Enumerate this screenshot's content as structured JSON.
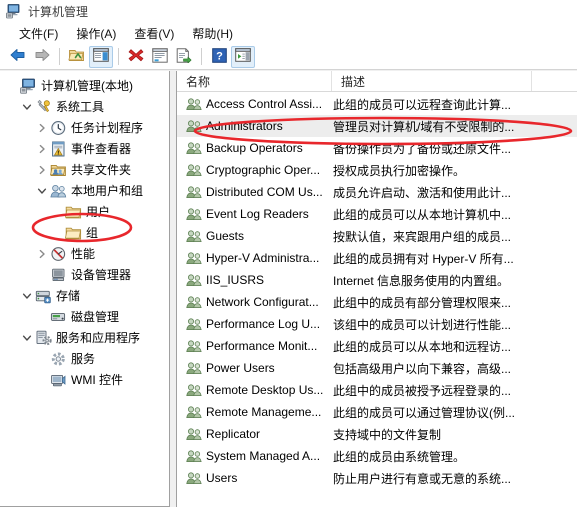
{
  "window": {
    "title": "计算机管理",
    "icon": "computer-management-icon"
  },
  "menu": {
    "items": [
      {
        "label": "文件(F)",
        "name": "menu-file"
      },
      {
        "label": "操作(A)",
        "name": "menu-action"
      },
      {
        "label": "查看(V)",
        "name": "menu-view"
      },
      {
        "label": "帮助(H)",
        "name": "menu-help"
      }
    ]
  },
  "toolbar": {
    "buttons": [
      {
        "icon": "back-arrow-icon",
        "name": "toolbar-back"
      },
      {
        "icon": "forward-arrow-icon",
        "name": "toolbar-forward"
      },
      {
        "icon": "up-folder-icon",
        "name": "toolbar-up-folder"
      },
      {
        "icon": "show-hide-tree-icon",
        "name": "toolbar-show-tree"
      },
      {
        "icon": "delete-red-x-icon",
        "name": "toolbar-delete"
      },
      {
        "icon": "properties-icon",
        "name": "toolbar-properties"
      },
      {
        "icon": "export-list-icon",
        "name": "toolbar-export-list"
      },
      {
        "icon": "help-question-icon",
        "name": "toolbar-help"
      },
      {
        "icon": "show-action-pane-icon",
        "name": "toolbar-action-pane"
      }
    ]
  },
  "tree": {
    "nodes": [
      {
        "label": "计算机管理(本地)",
        "indent": 0,
        "chevron": "none",
        "icon": "computer-icon",
        "name": "tree-computer-management-local"
      },
      {
        "label": "系统工具",
        "indent": 1,
        "chevron": "expanded",
        "icon": "system-tools-icon",
        "name": "tree-system-tools"
      },
      {
        "label": "任务计划程序",
        "indent": 2,
        "chevron": "collapsed",
        "icon": "task-scheduler-icon",
        "name": "tree-task-scheduler"
      },
      {
        "label": "事件查看器",
        "indent": 2,
        "chevron": "collapsed",
        "icon": "event-viewer-icon",
        "name": "tree-event-viewer"
      },
      {
        "label": "共享文件夹",
        "indent": 2,
        "chevron": "collapsed",
        "icon": "shared-folders-icon",
        "name": "tree-shared-folders"
      },
      {
        "label": "本地用户和组",
        "indent": 2,
        "chevron": "expanded",
        "icon": "local-users-groups-icon",
        "name": "tree-local-users-and-groups"
      },
      {
        "label": "用户",
        "indent": 3,
        "chevron": "none",
        "icon": "folder-icon",
        "name": "tree-users-folder"
      },
      {
        "label": "组",
        "indent": 3,
        "chevron": "none",
        "icon": "folder-icon",
        "name": "tree-groups-folder"
      },
      {
        "label": "性能",
        "indent": 2,
        "chevron": "collapsed",
        "icon": "performance-icon",
        "name": "tree-performance"
      },
      {
        "label": "设备管理器",
        "indent": 2,
        "chevron": "none",
        "icon": "device-manager-icon",
        "name": "tree-device-manager"
      },
      {
        "label": "存储",
        "indent": 1,
        "chevron": "expanded",
        "icon": "storage-icon",
        "name": "tree-storage"
      },
      {
        "label": "磁盘管理",
        "indent": 2,
        "chevron": "none",
        "icon": "disk-management-icon",
        "name": "tree-disk-management"
      },
      {
        "label": "服务和应用程序",
        "indent": 1,
        "chevron": "expanded",
        "icon": "services-apps-icon",
        "name": "tree-services-and-applications"
      },
      {
        "label": "服务",
        "indent": 2,
        "chevron": "none",
        "icon": "services-gear-icon",
        "name": "tree-services"
      },
      {
        "label": "WMI 控件",
        "indent": 2,
        "chevron": "none",
        "icon": "wmi-control-icon",
        "name": "tree-wmi-control"
      }
    ]
  },
  "list": {
    "columns": [
      {
        "label": "名称",
        "name": "column-header-name"
      },
      {
        "label": "描述",
        "name": "column-header-description"
      }
    ],
    "rows": [
      {
        "name": "Access Control Assi...",
        "description": "此组的成员可以远程查询此计算...",
        "selected": false,
        "icon": "group-icon"
      },
      {
        "name": "Administrators",
        "description": "管理员对计算机/域有不受限制的...",
        "selected": true,
        "icon": "group-icon"
      },
      {
        "name": "Backup Operators",
        "description": "备份操作员为了备份或还原文件...",
        "selected": false,
        "icon": "group-icon"
      },
      {
        "name": "Cryptographic Oper...",
        "description": "授权成员执行加密操作。",
        "selected": false,
        "icon": "group-icon"
      },
      {
        "name": "Distributed COM Us...",
        "description": "成员允许启动、激活和使用此计...",
        "selected": false,
        "icon": "group-icon"
      },
      {
        "name": "Event Log Readers",
        "description": "此组的成员可以从本地计算机中...",
        "selected": false,
        "icon": "group-icon"
      },
      {
        "name": "Guests",
        "description": "按默认值，来宾跟用户组的成员...",
        "selected": false,
        "icon": "group-icon"
      },
      {
        "name": "Hyper-V Administra...",
        "description": "此组的成员拥有对 Hyper-V 所有...",
        "selected": false,
        "icon": "group-icon"
      },
      {
        "name": "IIS_IUSRS",
        "description": "Internet 信息服务使用的内置组。",
        "selected": false,
        "icon": "group-icon"
      },
      {
        "name": "Network Configurat...",
        "description": "此组中的成员有部分管理权限来...",
        "selected": false,
        "icon": "group-icon"
      },
      {
        "name": "Performance Log U...",
        "description": "该组中的成员可以计划进行性能...",
        "selected": false,
        "icon": "group-icon"
      },
      {
        "name": "Performance Monit...",
        "description": "此组的成员可以从本地和远程访...",
        "selected": false,
        "icon": "group-icon"
      },
      {
        "name": "Power Users",
        "description": "包括高级用户以向下兼容，高级...",
        "selected": false,
        "icon": "group-icon"
      },
      {
        "name": "Remote Desktop Us...",
        "description": "此组中的成员被授予远程登录的...",
        "selected": false,
        "icon": "group-icon"
      },
      {
        "name": "Remote Manageme...",
        "description": "此组的成员可以通过管理协议(例...",
        "selected": false,
        "icon": "group-icon"
      },
      {
        "name": "Replicator",
        "description": "支持域中的文件复制",
        "selected": false,
        "icon": "group-icon"
      },
      {
        "name": "System Managed A...",
        "description": "此组的成员由系统管理。",
        "selected": false,
        "icon": "group-icon"
      },
      {
        "name": "Users",
        "description": "防止用户进行有意或无意的系统...",
        "selected": false,
        "icon": "group-icon"
      }
    ]
  },
  "annotations": {
    "color": "#e8272c",
    "marks": [
      {
        "name": "highlight-ellipse-groups-node",
        "target": "组"
      },
      {
        "name": "highlight-ellipse-administrators-row",
        "target": "Administrators"
      }
    ]
  }
}
